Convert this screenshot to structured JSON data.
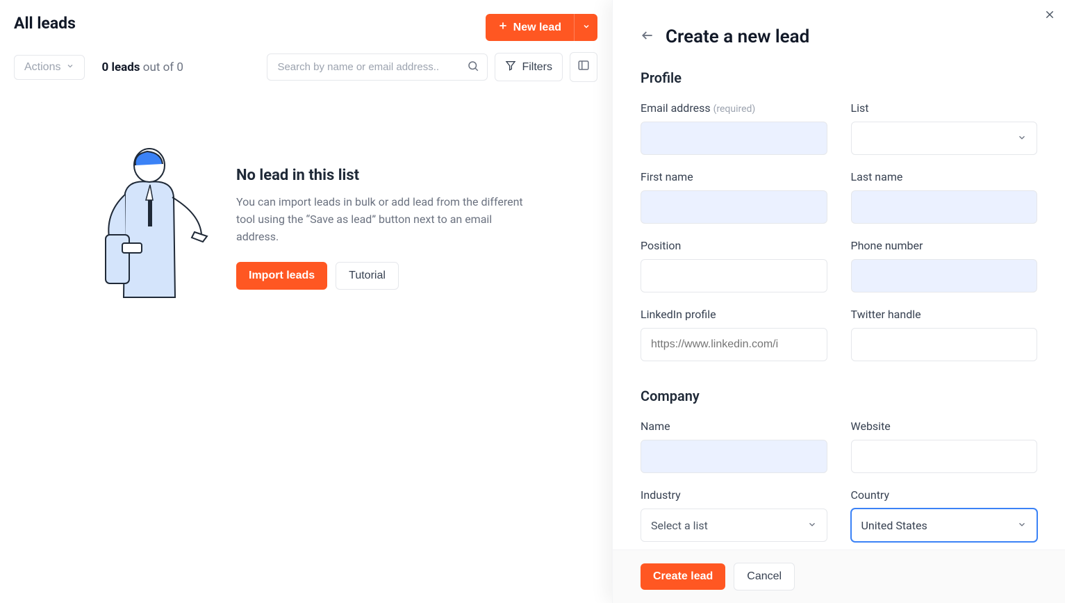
{
  "page": {
    "title": "All leads"
  },
  "toolbar": {
    "new_lead_label": "New lead"
  },
  "controls": {
    "actions_label": "Actions",
    "count_bold": "0 leads",
    "count_rest": " out of 0",
    "search_placeholder": "Search by name or email address..",
    "filters_label": "Filters"
  },
  "empty": {
    "title": "No lead in this list",
    "text": "You can import leads in bulk or add lead from the different tool using the “Save as lead” button next to an email address.",
    "import_label": "Import leads",
    "tutorial_label": "Tutorial"
  },
  "panel": {
    "title": "Create a new lead",
    "profile_section": "Profile",
    "company_section": "Company",
    "fields": {
      "email_label": "Email address",
      "email_req": "(required)",
      "list_label": "List",
      "first_name_label": "First name",
      "last_name_label": "Last name",
      "position_label": "Position",
      "phone_label": "Phone number",
      "linkedin_label": "LinkedIn profile",
      "linkedin_placeholder": "https://www.linkedin.com/i",
      "twitter_label": "Twitter handle",
      "company_name_label": "Name",
      "website_label": "Website",
      "industry_label": "Industry",
      "industry_placeholder": "Select a list",
      "country_label": "Country",
      "country_value": "United States"
    },
    "footer": {
      "create_label": "Create lead",
      "cancel_label": "Cancel"
    }
  }
}
